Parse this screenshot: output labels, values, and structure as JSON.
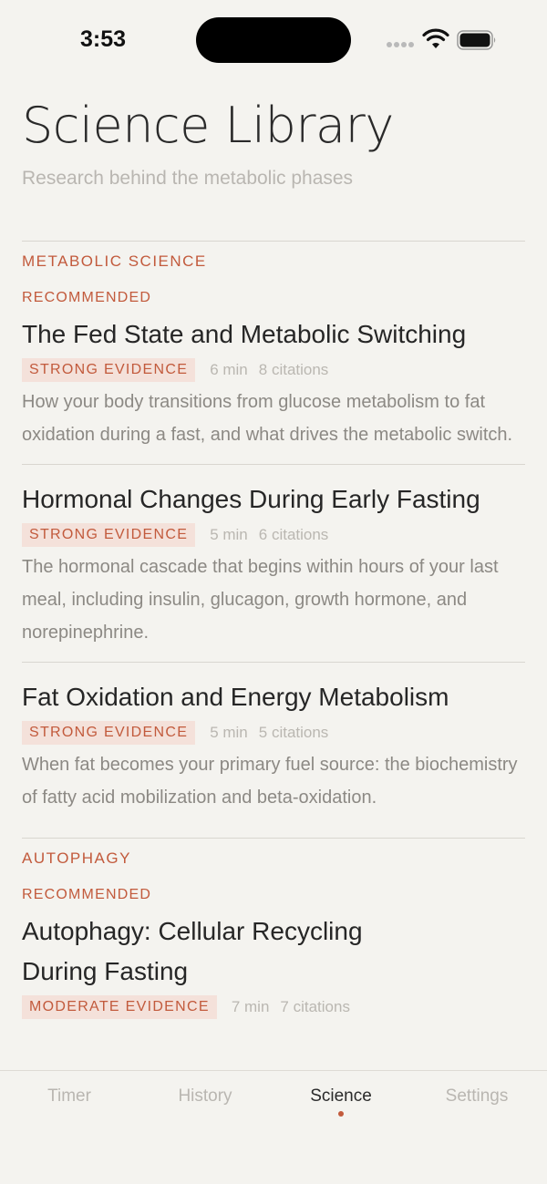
{
  "status_bar": {
    "time": "3:53"
  },
  "header": {
    "title": "Science Library",
    "subtitle": "Research behind the metabolic phases"
  },
  "sections": [
    {
      "title": "METABOLIC SCIENCE",
      "label": "RECOMMENDED",
      "articles": [
        {
          "title": "The Fed State and Metabolic Switching",
          "evidence": "STRONG EVIDENCE",
          "duration": "6 min",
          "citations": "8 citations",
          "description": "How your body transitions from glucose metabolism to fat oxidation during a fast, and what drives the metabolic switch."
        },
        {
          "title": "Hormonal Changes During Early Fasting",
          "evidence": "STRONG EVIDENCE",
          "duration": "5 min",
          "citations": "6 citations",
          "description": "The hormonal cascade that begins within hours of your last meal, including insulin, glucagon, growth hormone, and norepinephrine."
        },
        {
          "title": "Fat Oxidation and Energy Metabolism",
          "evidence": "STRONG EVIDENCE",
          "duration": "5 min",
          "citations": "5 citations",
          "description": "When fat becomes your primary fuel source: the biochemistry of fatty acid mobilization and beta-oxidation."
        }
      ]
    },
    {
      "title": "AUTOPHAGY",
      "label": "RECOMMENDED",
      "articles": [
        {
          "title": "Autophagy: Cellular Recycling During Fasting",
          "evidence": "MODERATE EVIDENCE",
          "duration": "7 min",
          "citations": "7 citations",
          "description": ""
        }
      ]
    }
  ],
  "tabs": [
    {
      "label": "Timer",
      "active": false
    },
    {
      "label": "History",
      "active": false
    },
    {
      "label": "Science",
      "active": true
    },
    {
      "label": "Settings",
      "active": false
    }
  ],
  "colors": {
    "background": "#f4f3ef",
    "accent": "#c25a3c",
    "badge_bg": "#f4e1da",
    "muted_text": "#b9b6b1",
    "body_text": "#8c8984"
  }
}
